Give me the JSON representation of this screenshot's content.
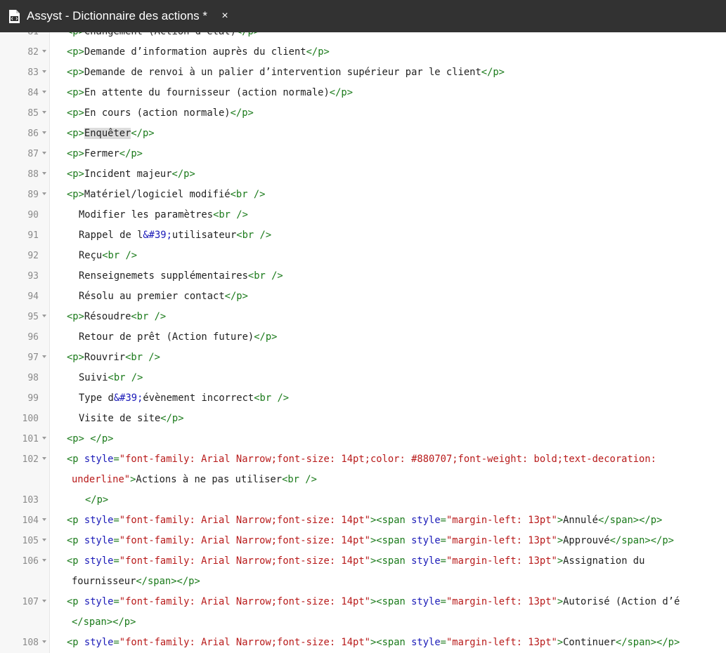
{
  "tab": {
    "title": "Assyst - Dictionnaire des actions *",
    "icon": "html-file-icon",
    "close": "×"
  },
  "editor": {
    "lines": [
      {
        "n": "81",
        "fold": true,
        "indent": 0,
        "parts": [
          [
            "tg",
            "<p>"
          ],
          [
            "tx",
            "Changement (Action d’état)"
          ],
          [
            "tg",
            "</p>"
          ]
        ]
      },
      {
        "n": "82",
        "fold": true,
        "indent": 0,
        "parts": [
          [
            "tg",
            "<p>"
          ],
          [
            "tx",
            "Demande d’information auprès du client"
          ],
          [
            "tg",
            "</p>"
          ]
        ]
      },
      {
        "n": "83",
        "fold": true,
        "indent": 0,
        "parts": [
          [
            "tg",
            "<p>"
          ],
          [
            "tx",
            "Demande de renvoi à un palier d’intervention supérieur par le client"
          ],
          [
            "tg",
            "</p>"
          ]
        ]
      },
      {
        "n": "84",
        "fold": true,
        "indent": 0,
        "parts": [
          [
            "tg",
            "<p>"
          ],
          [
            "tx",
            "En attente du fournisseur (action normale)"
          ],
          [
            "tg",
            "</p>"
          ]
        ]
      },
      {
        "n": "85",
        "fold": true,
        "indent": 0,
        "parts": [
          [
            "tg",
            "<p>"
          ],
          [
            "tx",
            "En cours (action normale)"
          ],
          [
            "tg",
            "</p>"
          ]
        ]
      },
      {
        "n": "86",
        "fold": true,
        "indent": 0,
        "parts": [
          [
            "tg",
            "<p>"
          ],
          [
            "hl",
            "Enquêter"
          ],
          [
            "tg",
            "</p>"
          ]
        ]
      },
      {
        "n": "87",
        "fold": true,
        "indent": 0,
        "parts": [
          [
            "tg",
            "<p>"
          ],
          [
            "tx",
            "Fermer"
          ],
          [
            "tg",
            "</p>"
          ]
        ]
      },
      {
        "n": "88",
        "fold": true,
        "indent": 0,
        "parts": [
          [
            "tg",
            "<p>"
          ],
          [
            "tx",
            "Incident majeur"
          ],
          [
            "tg",
            "</p>"
          ]
        ]
      },
      {
        "n": "89",
        "fold": true,
        "indent": 0,
        "parts": [
          [
            "tg",
            "<p>"
          ],
          [
            "tx",
            "Matériel/logiciel modifié"
          ],
          [
            "tg",
            "<br />"
          ]
        ]
      },
      {
        "n": "90",
        "fold": false,
        "indent": 1,
        "parts": [
          [
            "tx",
            "Modifier les paramètres"
          ],
          [
            "tg",
            "<br />"
          ]
        ]
      },
      {
        "n": "91",
        "fold": false,
        "indent": 1,
        "parts": [
          [
            "tx",
            "Rappel de l"
          ],
          [
            "en",
            "&#39;"
          ],
          [
            "tx",
            "utilisateur"
          ],
          [
            "tg",
            "<br />"
          ]
        ]
      },
      {
        "n": "92",
        "fold": false,
        "indent": 1,
        "parts": [
          [
            "tx",
            "Reçu"
          ],
          [
            "tg",
            "<br />"
          ]
        ]
      },
      {
        "n": "93",
        "fold": false,
        "indent": 1,
        "parts": [
          [
            "tx",
            "Renseignemets supplémentaires"
          ],
          [
            "tg",
            "<br />"
          ]
        ]
      },
      {
        "n": "94",
        "fold": false,
        "indent": 1,
        "parts": [
          [
            "tx",
            "Résolu au premier contact"
          ],
          [
            "tg",
            "</p>"
          ]
        ]
      },
      {
        "n": "95",
        "fold": true,
        "indent": 0,
        "parts": [
          [
            "tg",
            "<p>"
          ],
          [
            "tx",
            "Résoudre"
          ],
          [
            "tg",
            "<br />"
          ]
        ]
      },
      {
        "n": "96",
        "fold": false,
        "indent": 1,
        "parts": [
          [
            "tx",
            "Retour de prêt (Action future)"
          ],
          [
            "tg",
            "</p>"
          ]
        ]
      },
      {
        "n": "97",
        "fold": true,
        "indent": 0,
        "parts": [
          [
            "tg",
            "<p>"
          ],
          [
            "tx",
            "Rouvrir"
          ],
          [
            "tg",
            "<br />"
          ]
        ]
      },
      {
        "n": "98",
        "fold": false,
        "indent": 1,
        "parts": [
          [
            "tx",
            "Suivi"
          ],
          [
            "tg",
            "<br />"
          ]
        ]
      },
      {
        "n": "99",
        "fold": false,
        "indent": 1,
        "parts": [
          [
            "tx",
            "Type d"
          ],
          [
            "en",
            "&#39;"
          ],
          [
            "tx",
            "évènement incorrect"
          ],
          [
            "tg",
            "<br />"
          ]
        ]
      },
      {
        "n": "100",
        "fold": false,
        "indent": 1,
        "parts": [
          [
            "tx",
            "Visite de site"
          ],
          [
            "tg",
            "</p>"
          ]
        ]
      },
      {
        "n": "101",
        "fold": true,
        "indent": 0,
        "parts": [
          [
            "tg",
            "<p>"
          ],
          [
            "tx",
            " "
          ],
          [
            "tg",
            "</p>"
          ]
        ]
      },
      {
        "n": "102",
        "fold": true,
        "indent": 0,
        "parts": [
          [
            "tg",
            "<p "
          ],
          [
            "at",
            "style"
          ],
          [
            "tg",
            "="
          ],
          [
            "st",
            "\"font-family: Arial Narrow;font-size: 14pt;color: #880707;font-weight: bold;text-decoration:"
          ]
        ]
      },
      {
        "n": "",
        "fold": false,
        "indent": 3,
        "parts": [
          [
            "st",
            "underline\""
          ],
          [
            "tg",
            ">"
          ],
          [
            "tx",
            "Actions à ne pas utiliser"
          ],
          [
            "tg",
            "<br />"
          ]
        ]
      },
      {
        "n": "103",
        "fold": false,
        "indent": 2,
        "parts": [
          [
            "tg",
            "</p>"
          ]
        ]
      },
      {
        "n": "104",
        "fold": true,
        "indent": 0,
        "parts": [
          [
            "tg",
            "<p "
          ],
          [
            "at",
            "style"
          ],
          [
            "tg",
            "="
          ],
          [
            "st",
            "\"font-family: Arial Narrow;font-size: 14pt\""
          ],
          [
            "tg",
            "><span "
          ],
          [
            "at",
            "style"
          ],
          [
            "tg",
            "="
          ],
          [
            "st",
            "\"margin-left: 13pt\""
          ],
          [
            "tg",
            ">"
          ],
          [
            "tx",
            "Annulé"
          ],
          [
            "tg",
            "</span></p>"
          ]
        ]
      },
      {
        "n": "105",
        "fold": true,
        "indent": 0,
        "parts": [
          [
            "tg",
            "<p "
          ],
          [
            "at",
            "style"
          ],
          [
            "tg",
            "="
          ],
          [
            "st",
            "\"font-family: Arial Narrow;font-size: 14pt\""
          ],
          [
            "tg",
            "><span "
          ],
          [
            "at",
            "style"
          ],
          [
            "tg",
            "="
          ],
          [
            "st",
            "\"margin-left: 13pt\""
          ],
          [
            "tg",
            ">"
          ],
          [
            "tx",
            "Approuvé"
          ],
          [
            "tg",
            "</span></p>"
          ]
        ]
      },
      {
        "n": "106",
        "fold": true,
        "indent": 0,
        "parts": [
          [
            "tg",
            "<p "
          ],
          [
            "at",
            "style"
          ],
          [
            "tg",
            "="
          ],
          [
            "st",
            "\"font-family: Arial Narrow;font-size: 14pt\""
          ],
          [
            "tg",
            "><span "
          ],
          [
            "at",
            "style"
          ],
          [
            "tg",
            "="
          ],
          [
            "st",
            "\"margin-left: 13pt\""
          ],
          [
            "tg",
            ">"
          ],
          [
            "tx",
            "Assignation du"
          ]
        ]
      },
      {
        "n": "",
        "fold": false,
        "indent": 3,
        "parts": [
          [
            "tx",
            "fournisseur"
          ],
          [
            "tg",
            "</span></p>"
          ]
        ]
      },
      {
        "n": "107",
        "fold": true,
        "indent": 0,
        "parts": [
          [
            "tg",
            "<p "
          ],
          [
            "at",
            "style"
          ],
          [
            "tg",
            "="
          ],
          [
            "st",
            "\"font-family: Arial Narrow;font-size: 14pt\""
          ],
          [
            "tg",
            "><span "
          ],
          [
            "at",
            "style"
          ],
          [
            "tg",
            "="
          ],
          [
            "st",
            "\"margin-left: 13pt\""
          ],
          [
            "tg",
            ">"
          ],
          [
            "tx",
            "Autorisé (Action d’é"
          ]
        ]
      },
      {
        "n": "",
        "fold": false,
        "indent": 3,
        "parts": [
          [
            "tg",
            "</span></p>"
          ]
        ]
      },
      {
        "n": "108",
        "fold": true,
        "indent": 0,
        "parts": [
          [
            "tg",
            "<p "
          ],
          [
            "at",
            "style"
          ],
          [
            "tg",
            "="
          ],
          [
            "st",
            "\"font-family: Arial Narrow;font-size: 14pt\""
          ],
          [
            "tg",
            "><span "
          ],
          [
            "at",
            "style"
          ],
          [
            "tg",
            "="
          ],
          [
            "st",
            "\"margin-left: 13pt\""
          ],
          [
            "tg",
            ">"
          ],
          [
            "tx",
            "Continuer"
          ],
          [
            "tg",
            "</span></p>"
          ]
        ]
      }
    ]
  },
  "colors": {
    "titlebar": "#323232",
    "tag": "#1a7a1a",
    "attribute": "#1a1ab8",
    "string": "#b81a1a",
    "entity": "#1a1ab8",
    "highlight": "#dcdcdc"
  }
}
